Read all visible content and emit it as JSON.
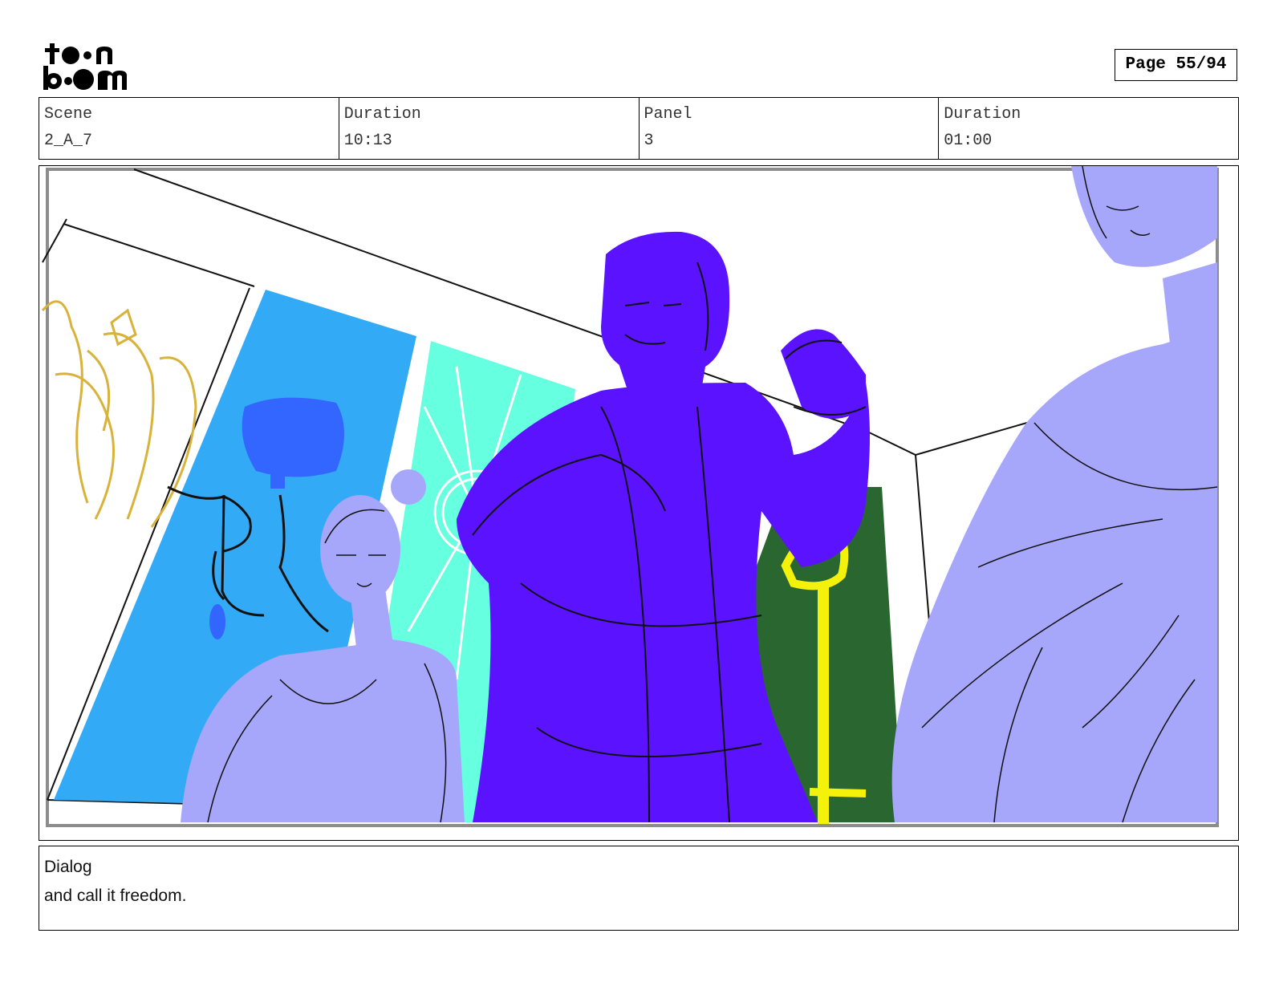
{
  "header": {
    "logo_text": "toon boom",
    "page_label": "Page 55/94"
  },
  "info": {
    "scene_label": "Scene",
    "scene_value": "2_A_7",
    "scene_duration_label": "Duration",
    "scene_duration_value": "10:13",
    "panel_label": "Panel",
    "panel_value": "3",
    "panel_duration_label": "Duration",
    "panel_duration_value": "01:00"
  },
  "panel_image": {
    "colors": {
      "blue_window": "#33aaf5",
      "cyan_window": "#66ffe0",
      "green_window": "#2a6630",
      "main_figure": "#5a12ff",
      "side_figures": "#a6a6fb",
      "yellow_staff": "#f4f20a",
      "gold_sketch": "#d9b23a"
    }
  },
  "dialog": {
    "label": "Dialog",
    "text": "and call it freedom."
  }
}
